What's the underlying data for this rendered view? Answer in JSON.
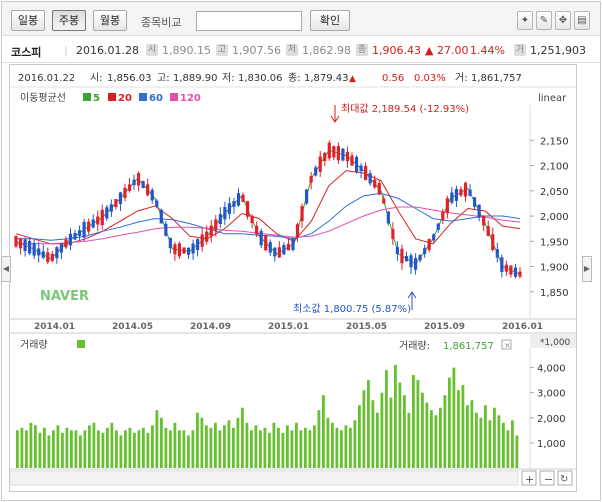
{
  "toolbar": {
    "daily": "일봉",
    "weekly": "주봉",
    "monthly": "월봉",
    "compare_label": "종목비교",
    "search_value": "",
    "confirm": "확인"
  },
  "info": {
    "name": "코스피",
    "date": "2016.01.28",
    "open_badge": "시",
    "open": "1,890.15",
    "high_badge": "고",
    "high": "1,907.56",
    "low_badge": "저",
    "low": "1,862.98",
    "close_badge": "종",
    "close": "1,906.43",
    "change": "▲ 27.00",
    "change_pct": "1.44%",
    "volume_badge": "거",
    "volume": "1,251,903"
  },
  "price_header": {
    "date": "2016.01.22",
    "open_label": "시:",
    "open": "1,856.03",
    "high_label": "고:",
    "high": "1,889.90",
    "low_label": "저:",
    "low": "1,830.06",
    "close_label": "종:",
    "close": "1,879.43",
    "arrow": "▲",
    "change": "0.56",
    "change_pct": "0.03%",
    "vol_label": "거:",
    "volume": "1,861,757"
  },
  "legend": {
    "title": "이동평균선",
    "items": [
      {
        "label": "5",
        "color": "#3aa62f"
      },
      {
        "label": "20",
        "color": "#d62020"
      },
      {
        "label": "60",
        "color": "#2f6fd6"
      },
      {
        "label": "120",
        "color": "#e050b0"
      }
    ],
    "scale": "linear"
  },
  "annotations": {
    "max": "최대값 2,189.54 (-12.93%)",
    "min": "최소값 1,800.75 (5.87%)"
  },
  "watermark": "NAVER",
  "volume_panel": {
    "title": "거래량",
    "readout_label": "거래량:",
    "readout": "1,861,757",
    "unit": "*1,000"
  },
  "colors": {
    "up": "#e0202a",
    "down": "#2356c9",
    "volume": "#66c12f",
    "ma5": "#3aa62f",
    "ma20": "#d62020",
    "ma60": "#2f6fd6",
    "ma120": "#e050b0"
  },
  "chart_data": [
    {
      "type": "candlestick",
      "x_ticks": [
        "2014.01",
        "2014.05",
        "2014.09",
        "2015.01",
        "2015.05",
        "2015.09",
        "2016.01"
      ],
      "ylim": [
        1800,
        2220
      ],
      "y_ticks": [
        1850,
        1900,
        1950,
        2000,
        2050,
        2100,
        2150
      ],
      "series": [
        {
          "name": "5",
          "values": [
            1950,
            1935,
            1915,
            1950,
            1975,
            1998,
            2035,
            2075,
            2035,
            1935,
            1930,
            1960,
            2005,
            2040,
            1960,
            1925,
            1945,
            2075,
            2130,
            2120,
            2090,
            2050,
            1925,
            1905,
            1955,
            2035,
            2055,
            1985,
            1900,
            1885
          ]
        },
        {
          "name": "20",
          "values": [
            1965,
            1955,
            1945,
            1945,
            1955,
            1970,
            1990,
            2010,
            2020,
            1995,
            1960,
            1955,
            1975,
            2005,
            1995,
            1965,
            1950,
            1990,
            2060,
            2090,
            2085,
            2070,
            2010,
            1955,
            1945,
            1985,
            2015,
            2010,
            1980,
            1975
          ]
        },
        {
          "name": "60",
          "values": [
            1955,
            1955,
            1952,
            1955,
            1960,
            1970,
            1978,
            1988,
            1995,
            1993,
            1985,
            1975,
            1965,
            1965,
            1962,
            1960,
            1955,
            1965,
            1990,
            2020,
            2040,
            2045,
            2035,
            2015,
            1995,
            1990,
            1995,
            2000,
            2000,
            1995
          ]
        },
        {
          "name": "120",
          "values": [
            1945,
            1945,
            1945,
            1947,
            1950,
            1955,
            1962,
            1968,
            1975,
            1978,
            1978,
            1976,
            1972,
            1970,
            1966,
            1962,
            1958,
            1960,
            1970,
            1985,
            2000,
            2012,
            2018,
            2018,
            2012,
            2006,
            2002,
            1998,
            1992,
            1988
          ]
        }
      ],
      "annotations": [
        {
          "label": "최대값",
          "value": 2189.54
        },
        {
          "label": "최소값",
          "value": 1800.75
        }
      ]
    },
    {
      "type": "bar",
      "title": "거래량",
      "unit": "*1,000",
      "ylim": [
        0,
        4500
      ],
      "y_ticks": [
        1000,
        2000,
        3000,
        4000
      ],
      "values": [
        1500,
        1600,
        1500,
        1800,
        1700,
        1400,
        1600,
        1300,
        1500,
        1700,
        1400,
        1600,
        1500,
        1500,
        1300,
        1500,
        1700,
        1800,
        1500,
        1400,
        1600,
        1800,
        1500,
        1300,
        1500,
        1600,
        1400,
        1500,
        1600,
        1400,
        1700,
        2300,
        2000,
        1600,
        1500,
        1800,
        1500,
        1500,
        1300,
        1500,
        2200,
        2000,
        1700,
        1600,
        1800,
        1500,
        1700,
        1900,
        1600,
        2000,
        2400,
        1800,
        1500,
        1700,
        1500,
        1600,
        1400,
        1800,
        1600,
        1400,
        1700,
        1500,
        1800,
        1500,
        1600,
        1500,
        1700,
        2300,
        2900,
        2000,
        1800,
        1600,
        1500,
        1700,
        1600,
        1900,
        2500,
        3100,
        3500,
        2700,
        2200,
        3000,
        3900,
        2800,
        4100,
        3400,
        2900,
        2200,
        3700,
        3500,
        3000,
        2600,
        2300,
        2100,
        2400,
        2900,
        3600,
        4000,
        3100,
        3300,
        2500,
        2700,
        2200,
        2000,
        2500,
        1900,
        2400,
        2100,
        1800,
        1500,
        1900,
        1300
      ]
    }
  ]
}
